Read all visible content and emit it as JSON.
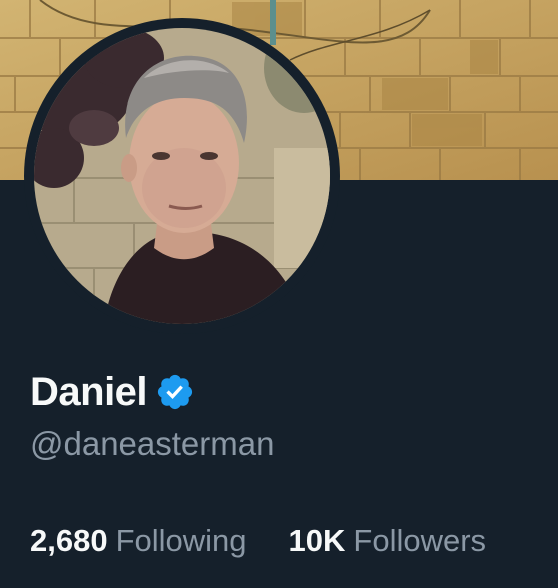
{
  "profile": {
    "display_name": "Daniel",
    "handle": "@daneasterman",
    "verified_badge_icon": "verified-badge-icon",
    "stats": {
      "following_count": "2,680",
      "following_label": "Following",
      "followers_count": "10K",
      "followers_label": "Followers"
    }
  },
  "colors": {
    "background": "#15202b",
    "primary_text": "#f7f9f9",
    "secondary_text": "#8b98a5",
    "verified_blue": "#1d9bf0"
  }
}
